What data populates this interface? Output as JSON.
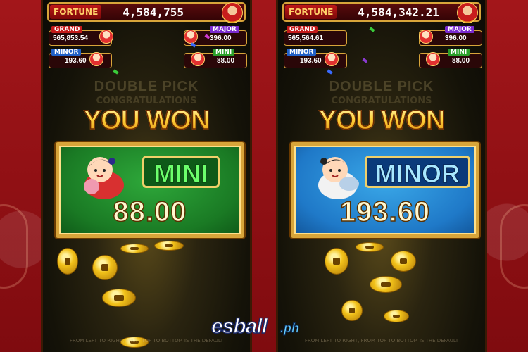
{
  "left_panel": {
    "fortune_label": "FORTUNE",
    "fortune_value": "4,584,755",
    "jackpots": {
      "grand": {
        "label": "GRAND",
        "value": "565,853.54"
      },
      "major": {
        "label": "MAJOR",
        "value": "396.00"
      },
      "minor": {
        "label": "MINOR",
        "value": "193.60"
      },
      "mini": {
        "label": "MINI",
        "value": "88.00"
      }
    },
    "double_pick": "DOUBLE PICK",
    "congrats": "CONGRATULATIONS",
    "you_won": "YOU WON",
    "prize_tier": "MINI",
    "prize_amount": "88.00",
    "prize_color": "#1a7a24"
  },
  "right_panel": {
    "fortune_label": "FORTUNE",
    "fortune_value": "4,584,342.21",
    "jackpots": {
      "grand": {
        "label": "GRAND",
        "value": "565,564.61"
      },
      "major": {
        "label": "MAJOR",
        "value": "396.00"
      },
      "minor": {
        "label": "MINOR",
        "value": "193.60"
      },
      "mini": {
        "label": "MINI",
        "value": "88.00"
      }
    },
    "double_pick": "DOUBLE PICK",
    "congrats": "CONGRATULATIONS",
    "you_won": "YOU WON",
    "prize_tier": "MINOR",
    "prize_amount": "193.60",
    "prize_color": "#1f79c8"
  },
  "footer": "FROM LEFT TO RIGHT, FROM TOP TO BOTTOM IS THE DEFAULT",
  "logo": {
    "main": "esball",
    "suffix": ".ph"
  },
  "colors": {
    "background": "#8e0f12",
    "gold": "#d8a53a",
    "grand": "#c41a1a",
    "major": "#7a2ad0",
    "minor": "#2160c8",
    "mini": "#2aa02a"
  }
}
